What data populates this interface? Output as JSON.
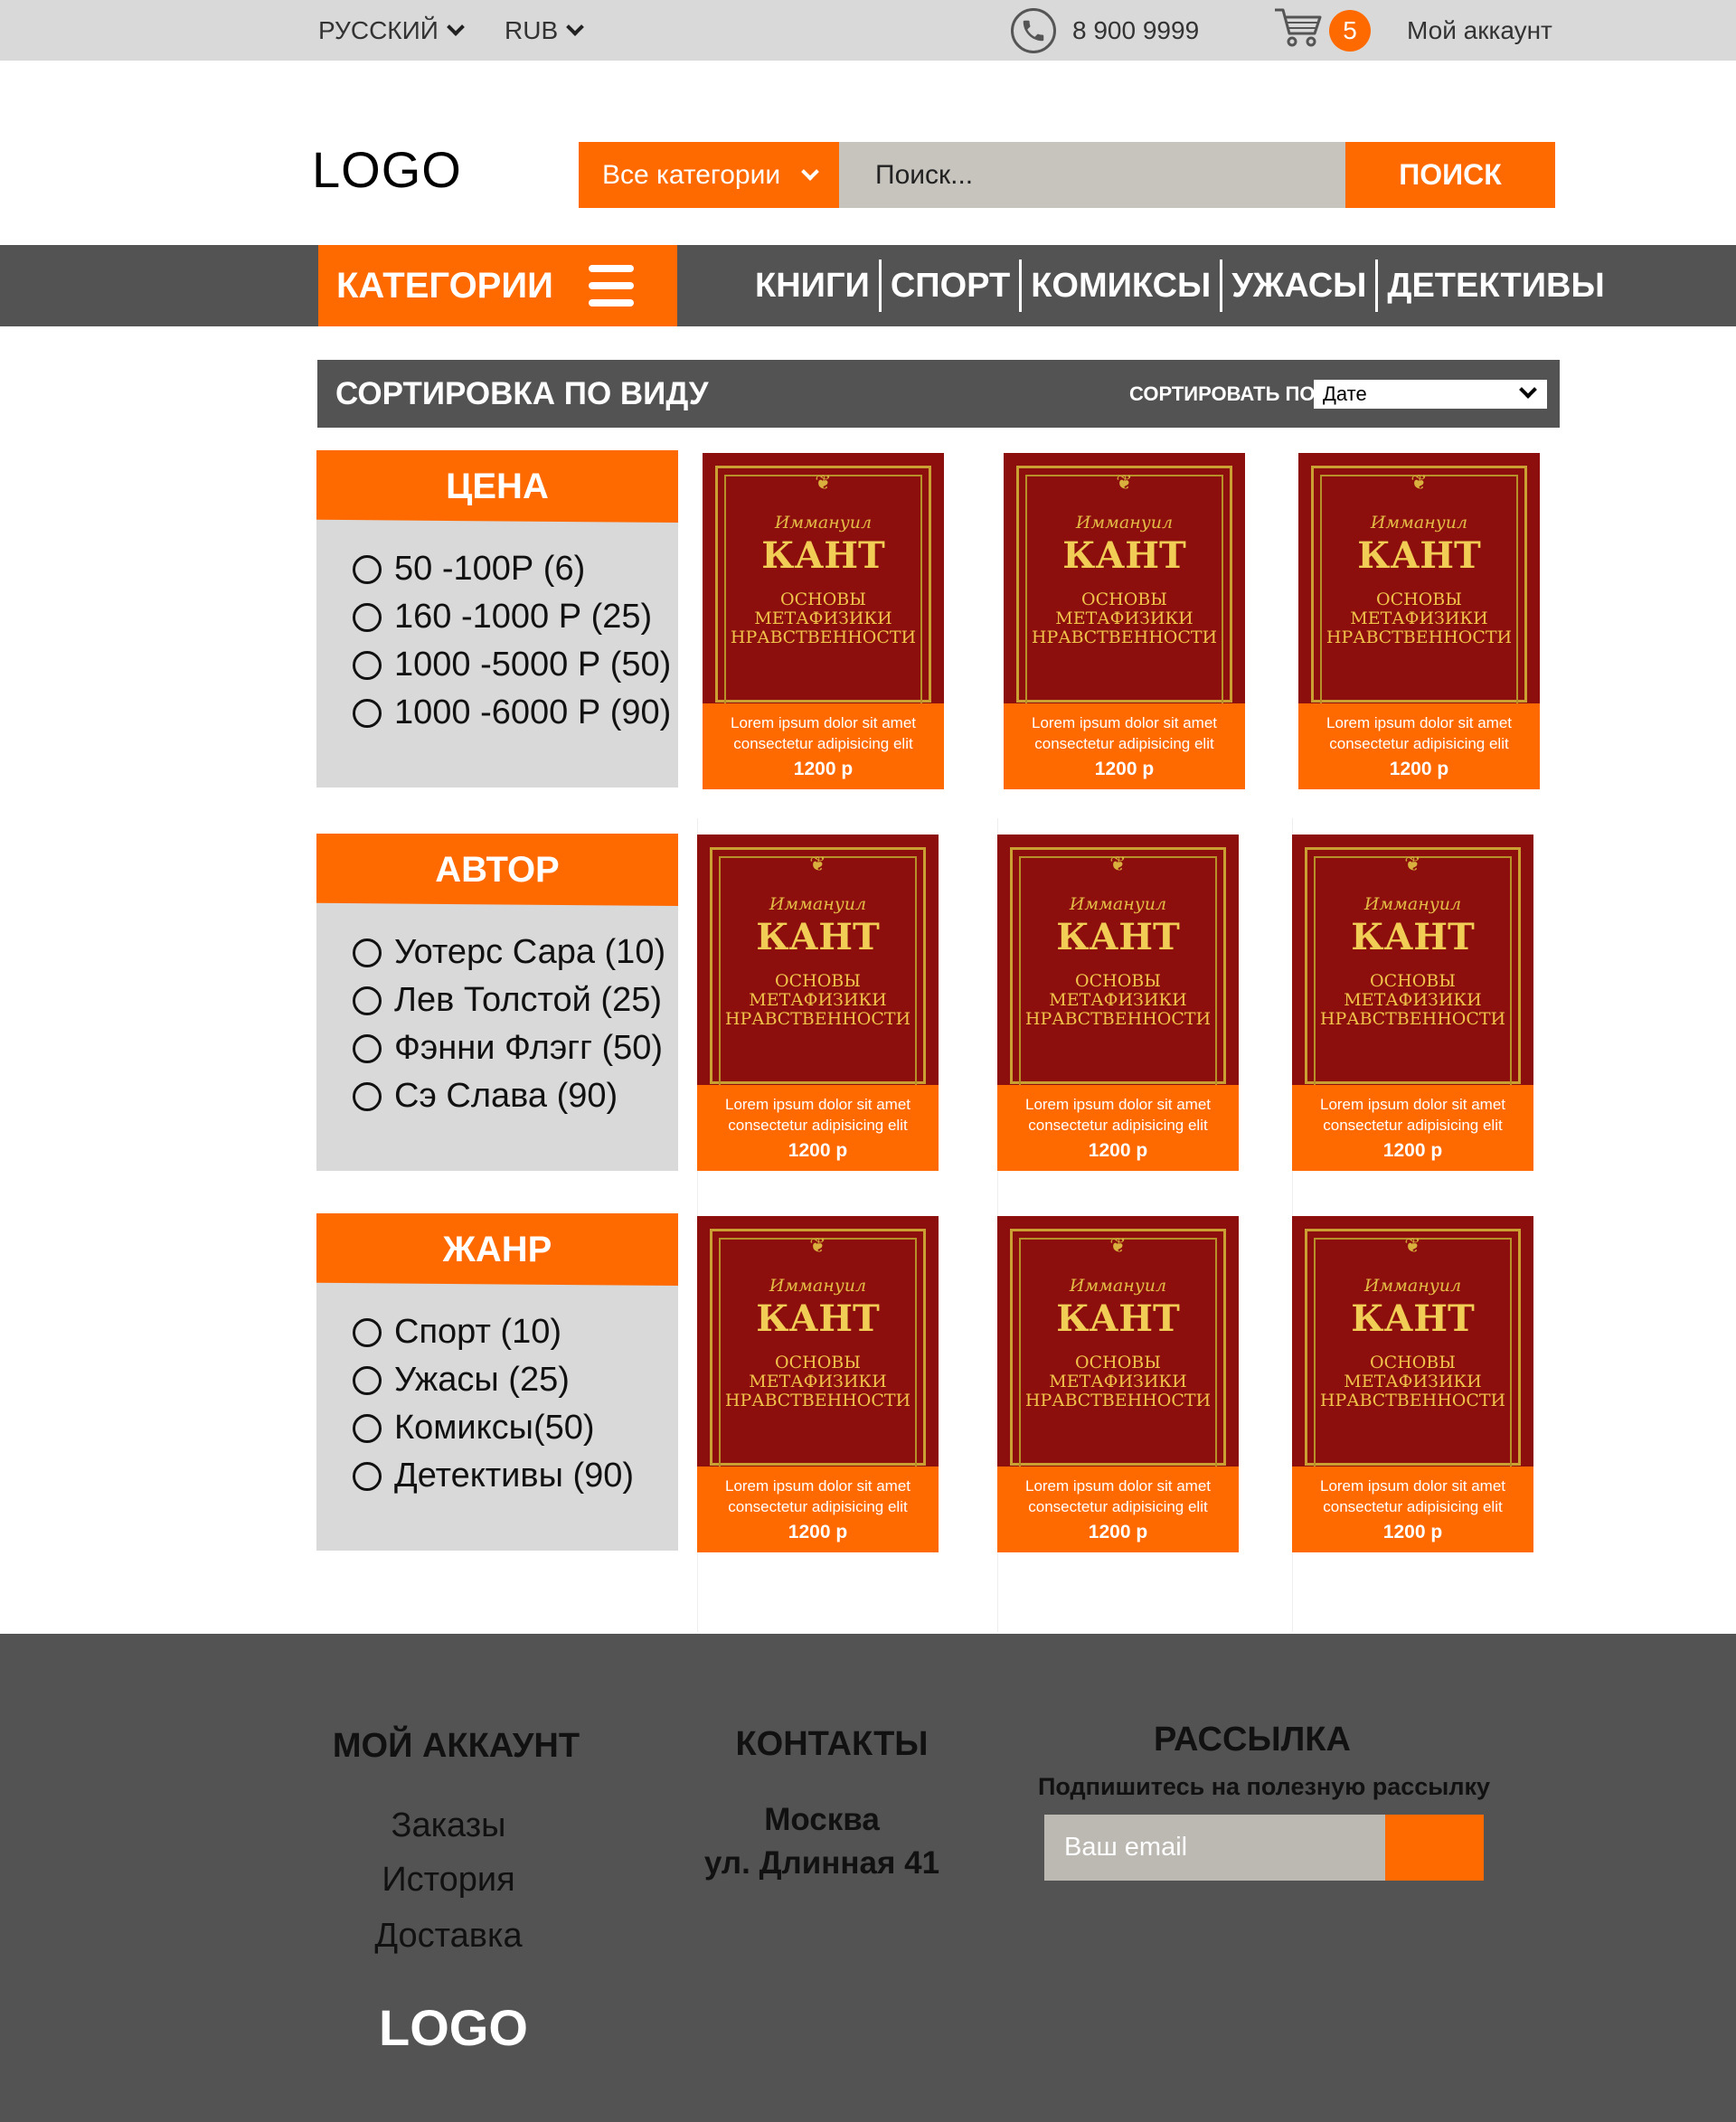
{
  "topbar": {
    "language": "РУССКИЙ",
    "currency": "RUB",
    "phone": "8 900 9999",
    "cart_count": "5",
    "account": "Мой аккаунт"
  },
  "header": {
    "logo": "LOGO",
    "category_select": "Все категории",
    "search_placeholder": "Поиск...",
    "search_button": "ПОИСК"
  },
  "nav": {
    "categories_button": "КАТЕГОРИИ",
    "links": [
      "КНИГИ",
      "СПОРТ",
      "КОМИКСЫ",
      "УЖАСЫ",
      "ДЕТЕКТИВЫ"
    ]
  },
  "sortbar": {
    "title": "СОРТИРОВКА ПО ВИДУ",
    "sort_label": "СОРТИРОВАТЬ ПО",
    "sort_value": "Дате"
  },
  "filters": [
    {
      "title": "ЦЕНА",
      "options": [
        "50 -100Р (6)",
        "160 -1000 Р (25)",
        "1000 -5000 Р (50)",
        "1000 -6000 Р (90)"
      ]
    },
    {
      "title": "АВТОР",
      "options": [
        "Уотерс Сара (10)",
        "Лев Толстой (25)",
        "Фэнни Флэгг (50)",
        "Сэ Слава (90)"
      ]
    },
    {
      "title": "ЖАНР",
      "options": [
        "Спорт (10)",
        "Ужасы (25)",
        "Комиксы(50)",
        "Детективы (90)"
      ]
    }
  ],
  "product_cover": {
    "author_small": "Иммануил",
    "author": "КАНТ",
    "title_lines": [
      "ОСНОВЫ",
      "МЕТАФИЗИКИ",
      "НРАВСТВЕННОСТИ"
    ]
  },
  "products": [
    {
      "desc1": "Lorem ipsum dolor sit amet",
      "desc2": "consectetur adipisicing elit",
      "price": "1200 р"
    },
    {
      "desc1": "Lorem ipsum dolor sit amet",
      "desc2": "consectetur adipisicing elit",
      "price": "1200 р"
    },
    {
      "desc1": "Lorem ipsum dolor sit amet",
      "desc2": "consectetur adipisicing elit",
      "price": "1200 р"
    },
    {
      "desc1": "Lorem ipsum dolor sit amet",
      "desc2": "consectetur adipisicing elit",
      "price": "1200 р"
    },
    {
      "desc1": "Lorem ipsum dolor sit amet",
      "desc2": "consectetur adipisicing elit",
      "price": "1200 р"
    },
    {
      "desc1": "Lorem ipsum dolor sit amet",
      "desc2": "consectetur adipisicing elit",
      "price": "1200 р"
    },
    {
      "desc1": "Lorem ipsum dolor sit amet",
      "desc2": "consectetur adipisicing elit",
      "price": "1200 р"
    },
    {
      "desc1": "Lorem ipsum dolor sit amet",
      "desc2": "consectetur adipisicing elit",
      "price": "1200 р"
    },
    {
      "desc1": "Lorem ipsum dolor sit amet",
      "desc2": "consectetur adipisicing elit",
      "price": "1200 р"
    }
  ],
  "footer": {
    "account_title": "МОЙ АККАУНТ",
    "account_links": [
      "Заказы",
      "История",
      "Доставка"
    ],
    "contacts_title": "КОНТАКТЫ",
    "city": "Москва",
    "address": "ул. Длинная 41",
    "newsletter_title": "РАССЫЛКА",
    "newsletter_sub": "Подпишитесь на полезную рассылку",
    "email_placeholder": "Ваш email",
    "logo": "LOGO"
  },
  "colors": {
    "accent": "#ff6a00",
    "dark": "#535353",
    "light_gray": "#d9d9d9"
  },
  "icons": [
    "chevron-down-icon",
    "phone-icon",
    "cart-icon",
    "hamburger-menu-icon",
    "radio-icon"
  ]
}
